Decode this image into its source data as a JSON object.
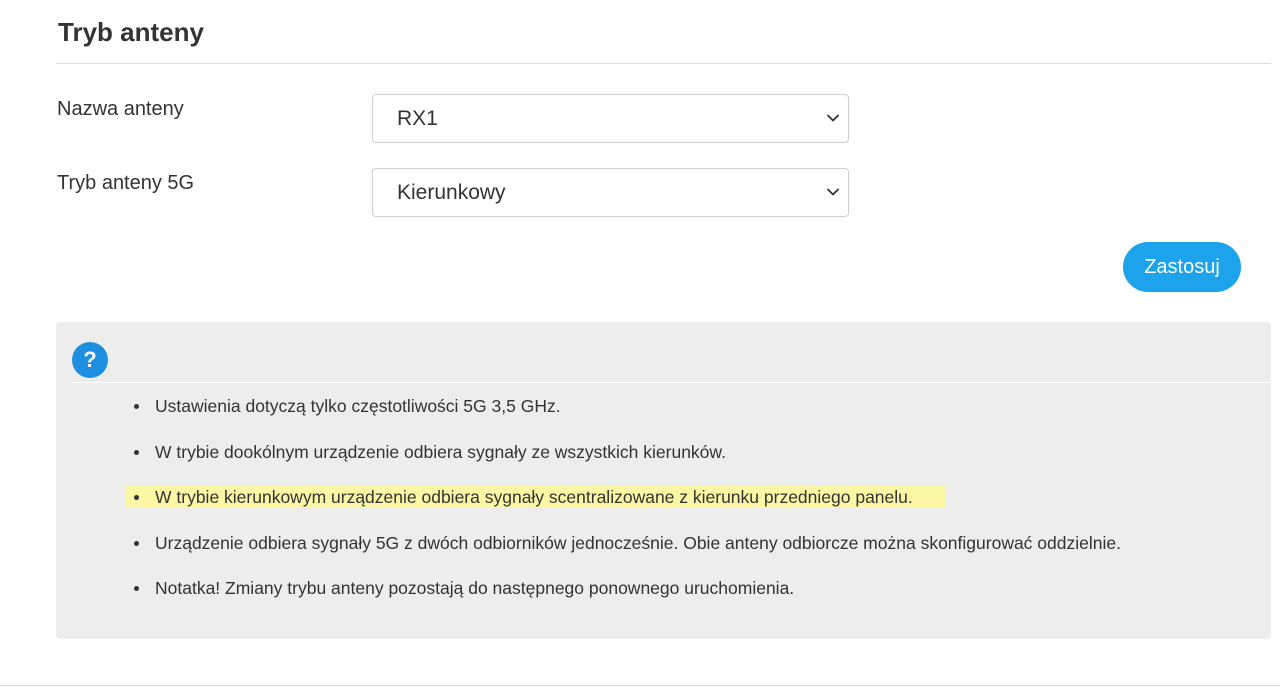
{
  "page": {
    "title": "Tryb anteny"
  },
  "form": {
    "antenna_name": {
      "label": "Nazwa anteny",
      "selected": "RX1"
    },
    "antenna_mode_5g": {
      "label": "Tryb anteny 5G",
      "selected": "Kierunkowy"
    },
    "apply_label": "Zastosuj"
  },
  "help": {
    "icon_glyph": "?",
    "items": [
      "Ustawienia dotyczą tylko częstotliwości 5G 3,5 GHz.",
      "W trybie dookólnym urządzenie odbiera sygnały ze wszystkich kierunków.",
      "W trybie kierunkowym urządzenie odbiera sygnały scentralizowane z kierunku przedniego panelu.",
      "Urządzenie odbiera sygnały 5G z dwóch odbiorników jednocześnie. Obie anteny odbiorcze można skonfigurować oddzielnie.",
      "Notatka! Zmiany trybu anteny pozostają do następnego ponownego uruchomienia."
    ],
    "highlighted_index": 2
  },
  "colors": {
    "accent": "#1ca3ec",
    "help_icon": "#1e8fe0",
    "panel_bg": "#ededed",
    "highlight": "#fbf7a4"
  },
  "icons": {
    "select_arrow": "chevron-down-icon",
    "help": "question-icon"
  }
}
